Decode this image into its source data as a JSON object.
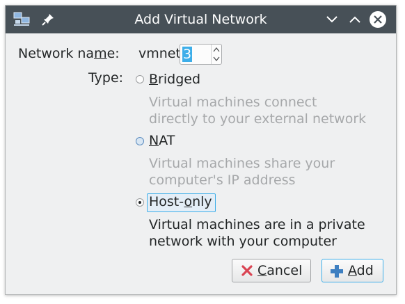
{
  "window": {
    "title": "Add Virtual Network",
    "app_icon": "network-icon",
    "pin_icon": "pin-icon",
    "controls": [
      "minimize-icon",
      "maximize-icon",
      "close-icon"
    ]
  },
  "form": {
    "network_name": {
      "label_pre": "Network na",
      "label_mnemonic": "m",
      "label_post": "e:",
      "prefix": "vmnet",
      "value": "3"
    },
    "type": {
      "label": "Type:",
      "options": [
        {
          "label_mnemonic": "B",
          "label_rest": "ridged",
          "description_line1": "Virtual machines connect",
          "description_line2": "directly to your external network",
          "enabled": false,
          "selected": false
        },
        {
          "label_mnemonic": "N",
          "label_rest": "AT",
          "description_line1": "Virtual machines share your",
          "description_line2": "computer's IP address",
          "enabled": false,
          "selected": false
        },
        {
          "label_pre": "Host-",
          "label_mnemonic": "o",
          "label_rest": "nly",
          "description_line1": "Virtual machines are in a private",
          "description_line2": "network with your computer",
          "enabled": true,
          "selected": true
        }
      ]
    }
  },
  "buttons": {
    "cancel": {
      "mnemonic": "C",
      "rest": "ancel",
      "icon": "cancel-icon"
    },
    "add": {
      "mnemonic": "A",
      "rest": "dd",
      "icon": "plus-icon"
    }
  },
  "colors": {
    "titlebar": "#475057",
    "window_bg": "#eff0f1",
    "accent": "#3daee9",
    "cancel_icon": "#da4453",
    "add_icon": "#3d7fc1"
  }
}
